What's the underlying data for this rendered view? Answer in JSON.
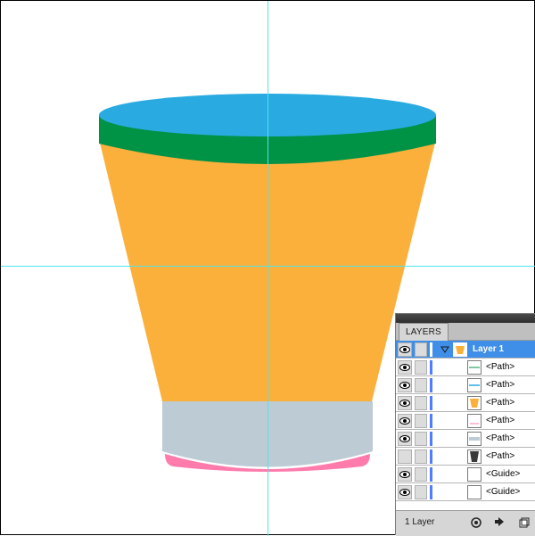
{
  "canvas": {
    "background": "#ffffff",
    "guide_color": "#4fe3f0",
    "cup": {
      "rim_top_color": "#29abe2",
      "rim_band_color": "#009245",
      "body_color": "#fbb03b",
      "base_color": "#bdccd4",
      "bottom_color": "#ff7bac"
    }
  },
  "layers_panel": {
    "tab_label": "LAYERS",
    "selection_color": "#3f8ee8",
    "layer_color": "#4f7dff",
    "layers": [
      {
        "label": "Layer 1",
        "thumb": "layer-icon"
      },
      {
        "label": "<Path>",
        "thumb": "path-line-icon"
      },
      {
        "label": "<Path>",
        "thumb": "path-line-icon"
      },
      {
        "label": "<Path>",
        "thumb": "path-orange-icon"
      },
      {
        "label": "<Path>",
        "thumb": "path-empty-icon"
      },
      {
        "label": "<Path>",
        "thumb": "path-gray-icon"
      },
      {
        "label": "<Path>",
        "thumb": "path-dark-icon"
      },
      {
        "label": "<Guide>",
        "thumb": "guide-icon"
      },
      {
        "label": "<Guide>",
        "thumb": "guide-icon"
      }
    ],
    "footer": {
      "count_label": "1 Layer",
      "buttons": [
        "make-clipping-mask-icon",
        "new-sublayer-icon",
        "new-layer-icon"
      ]
    }
  }
}
